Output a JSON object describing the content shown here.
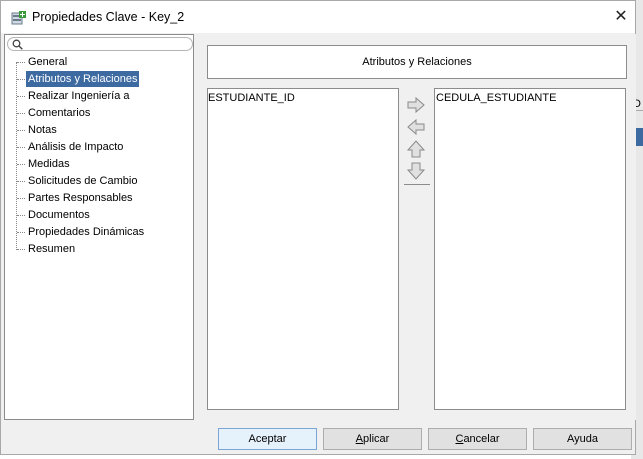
{
  "window": {
    "title": "Propiedades Clave - Key_2",
    "close_glyph": "✕"
  },
  "search": {
    "placeholder": ""
  },
  "tree": {
    "items": [
      {
        "label": "General",
        "selected": false
      },
      {
        "label": "Atributos y Relaciones",
        "selected": true
      },
      {
        "label": "Realizar Ingeniería a",
        "selected": false
      },
      {
        "label": "Comentarios",
        "selected": false
      },
      {
        "label": "Notas",
        "selected": false
      },
      {
        "label": "Análisis de Impacto",
        "selected": false
      },
      {
        "label": "Medidas",
        "selected": false
      },
      {
        "label": "Solicitudes de Cambio",
        "selected": false
      },
      {
        "label": "Partes Responsables",
        "selected": false
      },
      {
        "label": "Documentos",
        "selected": false
      },
      {
        "label": "Propiedades Dinámicas",
        "selected": false
      },
      {
        "label": "Resumen",
        "selected": false
      }
    ]
  },
  "panel": {
    "header": "Atributos y Relaciones",
    "available": [
      "ESTUDIANTE_ID"
    ],
    "selected": [
      "CEDULA_ESTUDIANTE"
    ],
    "arrow_icons": [
      "arrow-right-icon",
      "arrow-left-icon",
      "arrow-up-icon",
      "arrow-down-icon"
    ]
  },
  "buttons": {
    "ok": "Aceptar",
    "apply_m": "A",
    "apply_rest": "plicar",
    "cancel_m": "C",
    "cancel_rest": "ancelar",
    "help": "Ayuda"
  },
  "background": {
    "edge_char": "D"
  },
  "colors": {
    "selection": "#3e6aa2",
    "dialog_bg": "#f0f0f0",
    "primary_button_border": "#7aa6d6"
  }
}
